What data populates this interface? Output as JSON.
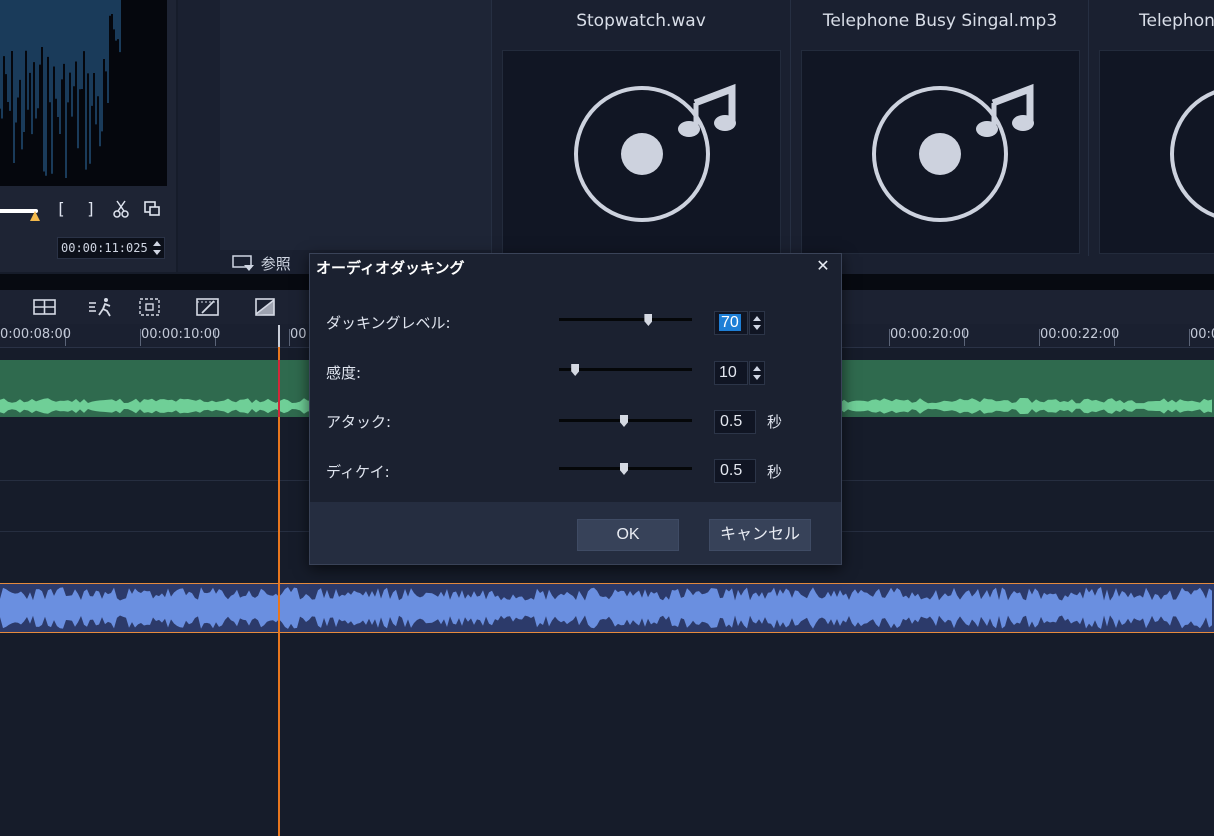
{
  "preview": {
    "mark_in_label": "[",
    "mark_out_label": "]",
    "timecode": "00:00:11:025"
  },
  "library": {
    "browse_label": "参照",
    "clips": [
      {
        "name": "Stopwatch.wav"
      },
      {
        "name": "Telephone Busy Singal.mp3"
      },
      {
        "name": "Telephone"
      }
    ]
  },
  "timeline": {
    "ruler_ticks": [
      "0:00:08:00",
      "00:00:10:00",
      "00",
      "00:00:20:00",
      "00:00:22:00",
      "00:0"
    ]
  },
  "dialog": {
    "title": "オーディオダッキング",
    "rows": [
      {
        "label": "ダッキングレベル:",
        "value": "70",
        "level": 0.7
      },
      {
        "label": "感度:",
        "value": "10",
        "level": 0.1
      },
      {
        "label": "アタック:",
        "value": "0.5",
        "unit": "秒",
        "level": 0.5
      },
      {
        "label": "ディケイ:",
        "value": "0.5",
        "unit": "秒",
        "level": 0.5
      }
    ],
    "ok_label": "OK",
    "cancel_label": "キャンセル"
  },
  "colors": {
    "accent": "#1e7fd6",
    "playhead": "#e8761e",
    "audio_green": "#6fcf97",
    "audio_blue": "#6a8fe0"
  }
}
